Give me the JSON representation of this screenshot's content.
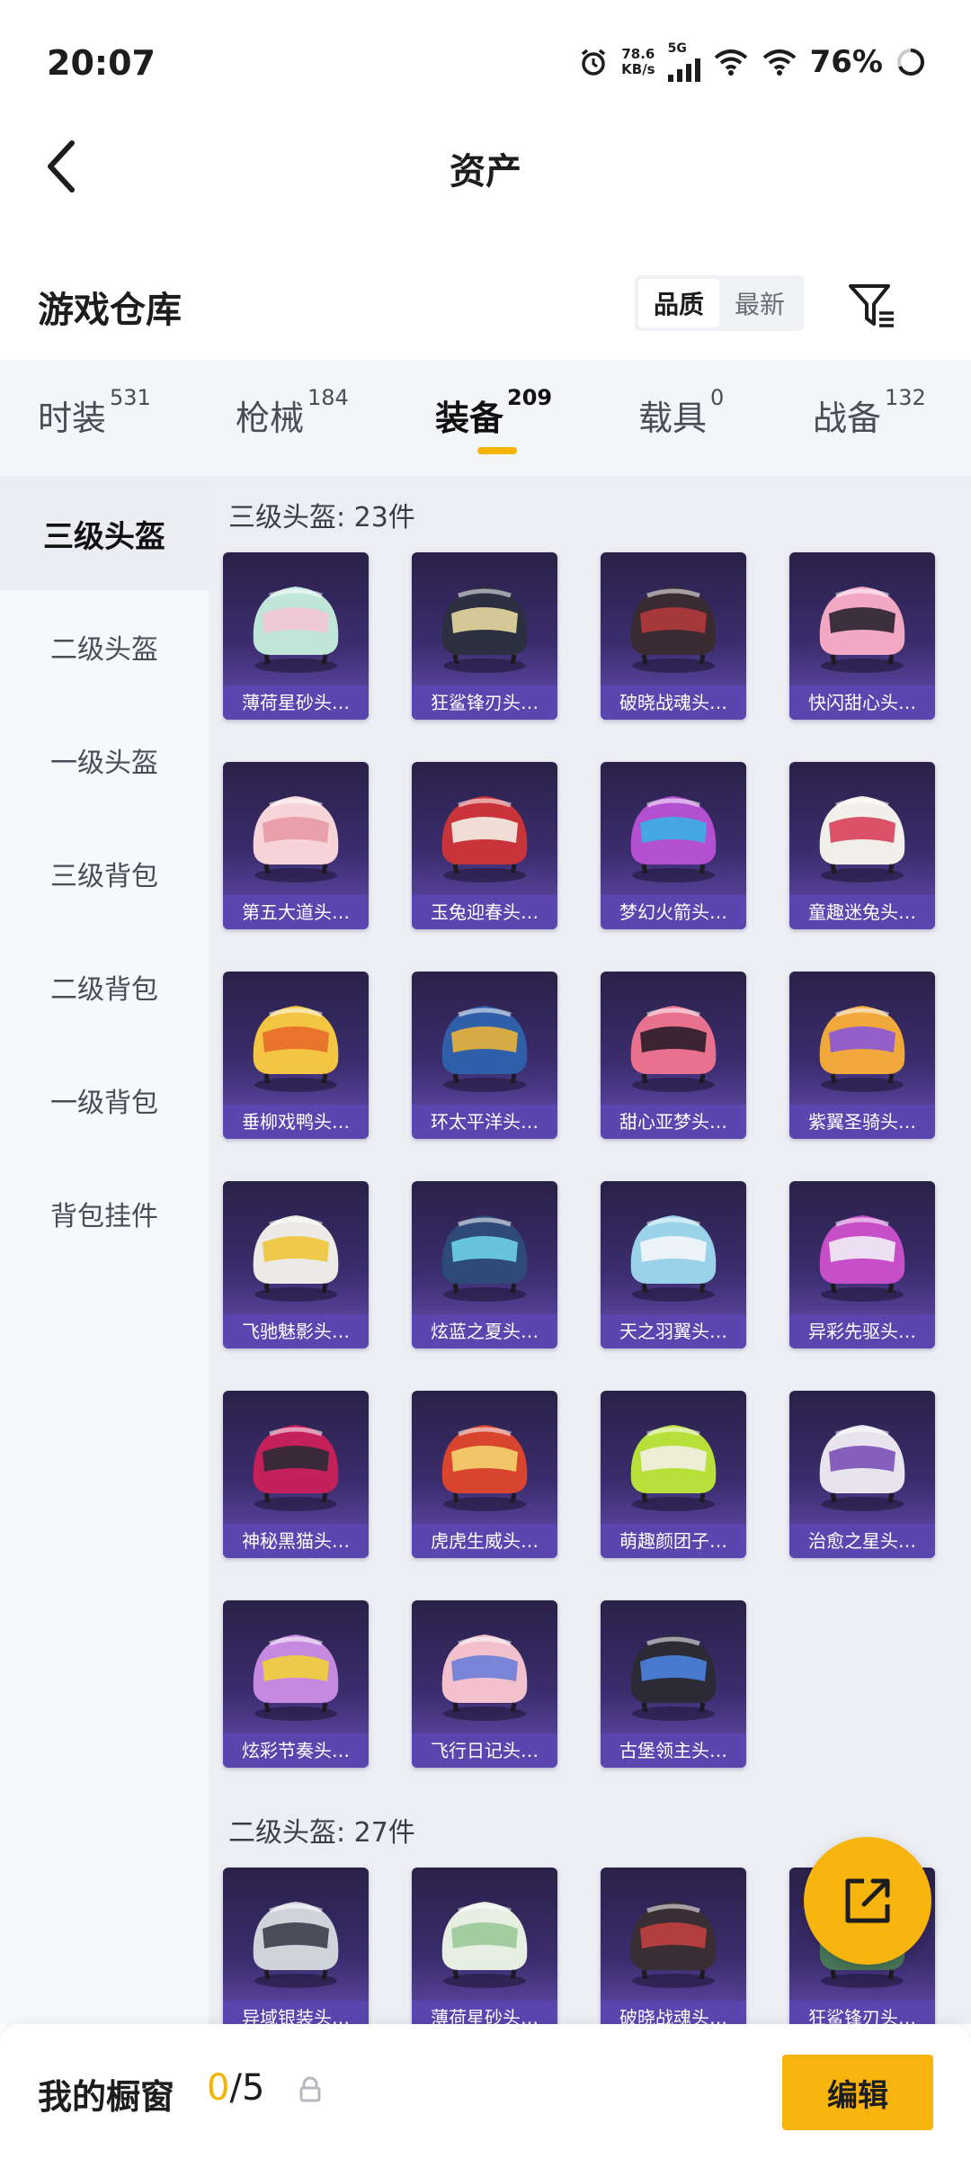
{
  "status": {
    "time": "20:07",
    "speed_value": "78.6",
    "speed_unit": "KB/s",
    "network": "5G",
    "battery": "76%"
  },
  "nav": {
    "title": "资产"
  },
  "warehouse": {
    "title": "游戏仓库",
    "sort_quality": "品质",
    "sort_newest": "最新"
  },
  "tabs": [
    {
      "label": "时装",
      "count": "531"
    },
    {
      "label": "枪械",
      "count": "184"
    },
    {
      "label": "装备",
      "count": "209"
    },
    {
      "label": "载具",
      "count": "0"
    },
    {
      "label": "战备",
      "count": "132"
    }
  ],
  "sidebar": [
    "三级头盔",
    "二级头盔",
    "一级头盔",
    "三级背包",
    "二级背包",
    "一级背包",
    "背包挂件"
  ],
  "sections": [
    {
      "title": "三级头盔: 23件",
      "items": [
        {
          "name": "薄荷星砂头…",
          "color": "#bfe6d8",
          "accent": "#f2c6d6"
        },
        {
          "name": "狂鲨锋刃头…",
          "color": "#2b2f3f",
          "accent": "#e8d9a0"
        },
        {
          "name": "破晓战魂头…",
          "color": "#3a2a32",
          "accent": "#b33a3a"
        },
        {
          "name": "快闪甜心头…",
          "color": "#f2a7c3",
          "accent": "#2a2230"
        },
        {
          "name": "第五大道头…",
          "color": "#f6d4d8",
          "accent": "#e89aa6"
        },
        {
          "name": "玉兔迎春头…",
          "color": "#c9343a",
          "accent": "#f3efe8"
        },
        {
          "name": "梦幻火箭头…",
          "color": "#b34fd1",
          "accent": "#3ab0e8"
        },
        {
          "name": "童趣迷兔头…",
          "color": "#f1efe9",
          "accent": "#d8405a"
        },
        {
          "name": "垂柳戏鸭头…",
          "color": "#f4c543",
          "accent": "#e86c2b"
        },
        {
          "name": "环太平洋头…",
          "color": "#2f5fa8",
          "accent": "#e9b23a"
        },
        {
          "name": "甜心亚梦头…",
          "color": "#e8728e",
          "accent": "#2a1c28"
        },
        {
          "name": "紫翼圣骑头…",
          "color": "#f0a93a",
          "accent": "#8a56d8"
        },
        {
          "name": "飞驰魅影头…",
          "color": "#eceae6",
          "accent": "#f0c638"
        },
        {
          "name": "炫蓝之夏头…",
          "color": "#2e4a78",
          "accent": "#6fd0e8"
        },
        {
          "name": "天之羽翼头…",
          "color": "#9ad2ea",
          "accent": "#f4f6fb"
        },
        {
          "name": "异彩先驱头…",
          "color": "#c64fc8",
          "accent": "#f1edf6"
        },
        {
          "name": "神秘黑猫头…",
          "color": "#c4205a",
          "accent": "#2a2a36"
        },
        {
          "name": "虎虎生威头…",
          "color": "#d8442e",
          "accent": "#f4d36b"
        },
        {
          "name": "萌趣颜团子…",
          "color": "#b7e03a",
          "accent": "#f3f0e6"
        },
        {
          "name": "治愈之星头…",
          "color": "#e7e4ee",
          "accent": "#7b4fb8"
        },
        {
          "name": "炫彩节奏头…",
          "color": "#c589e0",
          "accent": "#f2d13a"
        },
        {
          "name": "飞行日记头…",
          "color": "#f2c1cd",
          "accent": "#6b7fd8"
        },
        {
          "name": "古堡领主头…",
          "color": "#2b2a36",
          "accent": "#4a82e0"
        }
      ]
    },
    {
      "title": "二级头盔: 27件",
      "items": [
        {
          "name": "异域银装头…",
          "color": "#cfd3da",
          "accent": "#3a3e4a"
        },
        {
          "name": "薄荷星砂头…",
          "color": "#e6efe2",
          "accent": "#9ac99a"
        },
        {
          "name": "破晓战魂头…",
          "color": "#3a2e34",
          "accent": "#c04040"
        },
        {
          "name": "狂鲨锋刃头…",
          "color": "#4a7a5a",
          "accent": "#e8e8e8"
        }
      ]
    }
  ],
  "bottom": {
    "title": "我的橱窗",
    "current": "0",
    "separator": "/",
    "max": "5",
    "edit_label": "编辑"
  },
  "colors": {
    "accent": "#f7b40c",
    "card_bg": "#3b2d6e",
    "label_bg": "#5b46b0"
  }
}
